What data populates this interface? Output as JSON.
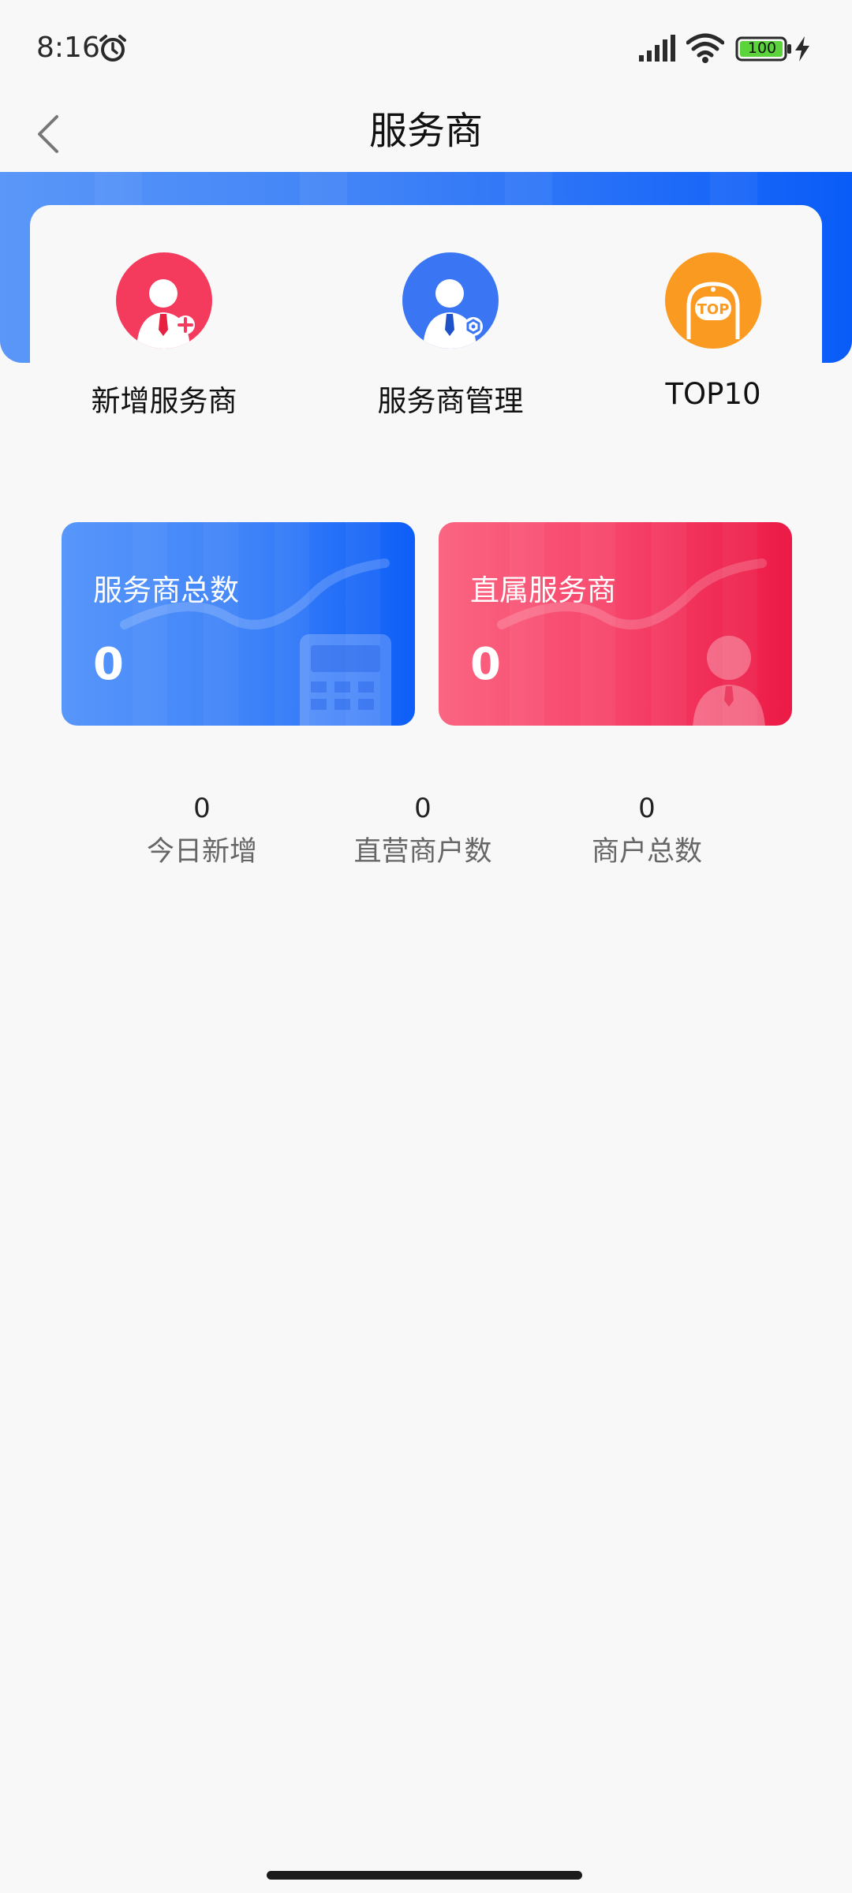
{
  "status_bar": {
    "time": "8:16",
    "battery": "100",
    "icons": [
      "alarm-icon",
      "signal-icon",
      "wifi-icon",
      "battery-icon",
      "charge-icon"
    ]
  },
  "nav": {
    "title": "服务商",
    "back_icon": "chevron-left-icon"
  },
  "actions": [
    {
      "label": "新增服务商",
      "icon": "add-person-icon",
      "color": "#f43b5e"
    },
    {
      "label": "服务商管理",
      "icon": "manage-person-icon",
      "color": "#3a76f4"
    },
    {
      "label": "TOP10",
      "icon": "top-badge-icon",
      "color": "#fb9a21"
    }
  ],
  "stat_cards": [
    {
      "title": "服务商总数",
      "value": "0",
      "icon": "calculator-icon"
    },
    {
      "title": "直属服务商",
      "value": "0",
      "icon": "person-icon"
    }
  ],
  "summary": [
    {
      "value": "0",
      "label": "今日新增"
    },
    {
      "value": "0",
      "label": "直营商户数"
    },
    {
      "value": "0",
      "label": "商户总数"
    }
  ],
  "colors": {
    "brand_blue": "#0a5cf8",
    "brand_red": "#ec1a46",
    "accent_orange": "#fb9a21",
    "background": "#f8f8f8"
  }
}
